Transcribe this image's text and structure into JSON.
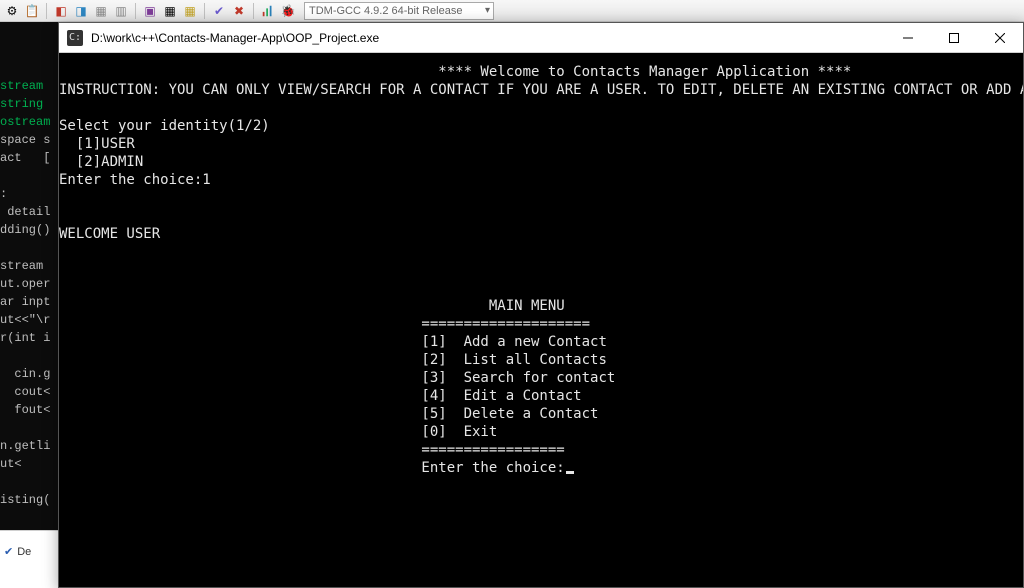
{
  "ide": {
    "compiler": "TDM-GCC 4.9.2 64-bit Release",
    "toolbar_icons": [
      "⚙",
      "📋",
      "",
      "",
      "",
      "",
      "",
      "",
      "",
      "✓",
      "✗",
      "📊",
      "🐞"
    ],
    "editor_fragments": [
      {
        "cls": "kw-green",
        "t": "stream"
      },
      {
        "cls": "kw-green",
        "t": "string"
      },
      {
        "cls": "kw-green",
        "t": "ostream"
      },
      {
        "cls": "",
        "t": "space s"
      },
      {
        "cls": "",
        "t": "act   ["
      },
      {
        "cls": "",
        "t": ""
      },
      {
        "cls": "",
        "t": ":"
      },
      {
        "cls": "",
        "t": " detail"
      },
      {
        "cls": "",
        "t": "dding()"
      },
      {
        "cls": "",
        "t": ""
      },
      {
        "cls": "",
        "t": "stream"
      },
      {
        "cls": "",
        "t": "ut.oper"
      },
      {
        "cls": "",
        "t": "ar inpt"
      },
      {
        "cls": "",
        "t": "ut<<\"\\r"
      },
      {
        "cls": "",
        "t": "r(int i"
      },
      {
        "cls": "",
        "t": ""
      },
      {
        "cls": "",
        "t": "  cin.g"
      },
      {
        "cls": "",
        "t": "  cout<"
      },
      {
        "cls": "",
        "t": "  fout<"
      },
      {
        "cls": "",
        "t": ""
      },
      {
        "cls": "",
        "t": "n.getli"
      },
      {
        "cls": "",
        "t": "ut<<inp"
      },
      {
        "cls": "",
        "t": ""
      },
      {
        "cls": "",
        "t": "isting("
      }
    ],
    "bottom_label": "De"
  },
  "window": {
    "title": "D:\\work\\c++\\Contacts-Manager-App\\OOP_Project.exe"
  },
  "console": {
    "welcome_banner": "**** Welcome to Contacts Manager Application ****",
    "instruction": "INSTRUCTION: YOU CAN ONLY VIEW/SEARCH FOR A CONTACT IF YOU ARE A USER. TO EDIT, DELETE AN EXISTING CONTACT OR ADD ANY NEW CONTACT, SIGN IN AS ADMINISTRATOR.",
    "select_prompt": "Select your identity(1/2)",
    "option_user": "[1]USER",
    "option_admin": "[2]ADMIN",
    "enter_choice_label": "Enter the choice:",
    "entered_identity": "1",
    "welcome_user": "WELCOME USER",
    "menu_title": "MAIN MENU",
    "menu_sep": "====================",
    "menu_items": [
      "[1]  Add a new Contact",
      "[2]  List all Contacts",
      "[3]  Search for contact",
      "[4]  Edit a Contact",
      "[5]  Delete a Contact",
      "[0]  Exit"
    ],
    "menu_sep2": "=================",
    "enter_menu_choice": "Enter the choice:"
  }
}
